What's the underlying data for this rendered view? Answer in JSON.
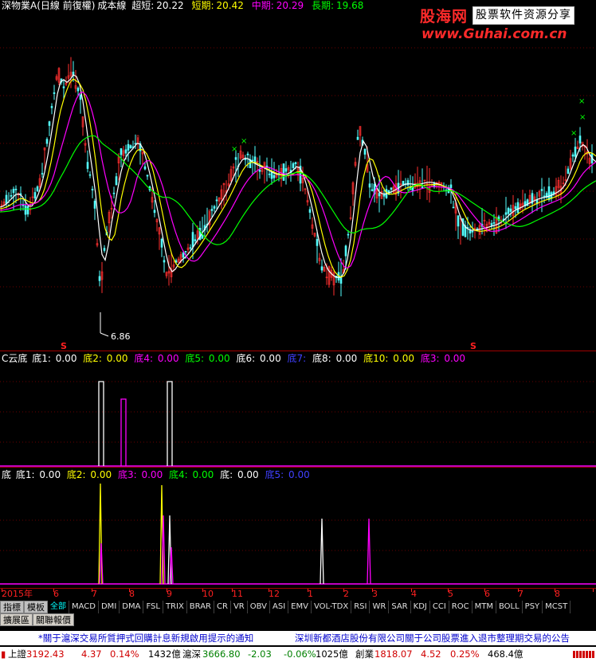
{
  "main": {
    "legend": {
      "title": "深物業A(日線 前復權)",
      "indicator": "成本線",
      "items": [
        {
          "label": "超短:",
          "value": "20.22",
          "color": "#ffffff"
        },
        {
          "label": "短期:",
          "value": "20.42",
          "color": "#ffff00"
        },
        {
          "label": "中期:",
          "value": "20.29",
          "color": "#ff00ff"
        },
        {
          "label": "長期:",
          "value": "19.68",
          "color": "#00ff00"
        }
      ]
    },
    "low_label": "6.86",
    "signal_glyph": "S"
  },
  "logo": {
    "name": "股海网",
    "slogan": "股票软件资源分享",
    "url": "www.Guhai.com.cn"
  },
  "ind1": {
    "name": "C云底",
    "items": [
      {
        "label": "底1:",
        "value": "0.00",
        "color": "#ffffff"
      },
      {
        "label": "底2:",
        "value": "0.00",
        "color": "#ffff00"
      },
      {
        "label": "底4:",
        "value": "0.00",
        "color": "#ff00ff"
      },
      {
        "label": "底5:",
        "value": "0.00",
        "color": "#00ff00"
      },
      {
        "label": "底6:",
        "value": "0.00",
        "color": "#ffffff"
      },
      {
        "label": "底7:",
        "value": "",
        "color": "#4040ff"
      },
      {
        "label": "底8:",
        "value": "0.00",
        "color": "#ffffff"
      },
      {
        "label": "底10:",
        "value": "0.00",
        "color": "#ffff00"
      },
      {
        "label": "底3:",
        "value": "0.00",
        "color": "#ff00ff"
      }
    ]
  },
  "ind2": {
    "name": "底",
    "items": [
      {
        "label": "底1:",
        "value": "0.00",
        "color": "#ffffff"
      },
      {
        "label": "底2:",
        "value": "0.00",
        "color": "#ffff00"
      },
      {
        "label": "底3:",
        "value": "0.00",
        "color": "#ff00ff"
      },
      {
        "label": "底4:",
        "value": "0.00",
        "color": "#00ff00"
      },
      {
        "label": "底:",
        "value": "0.00",
        "color": "#ffffff"
      },
      {
        "label": "底5:",
        "value": "0.00",
        "color": "#4040ff"
      }
    ]
  },
  "date_axis": [
    "2015年",
    "6",
    "7",
    "8",
    "9",
    "10",
    "11",
    "12",
    "1",
    "2",
    "3",
    "4",
    "5",
    "6",
    "7",
    "8"
  ],
  "tabs": {
    "side1": "指標",
    "side2": "模板",
    "items": [
      "全部",
      "MACD",
      "DMI",
      "DMA",
      "FSL",
      "TRIX",
      "BRAR",
      "CR",
      "VR",
      "OBV",
      "ASI",
      "EMV",
      "VOL-TDX",
      "RSI",
      "WR",
      "SAR",
      "KDJ",
      "CCI",
      "ROC",
      "MTM",
      "BOLL",
      "PSY",
      "MCST"
    ],
    "row2": [
      "擴展區",
      "關聯報價"
    ]
  },
  "notice": {
    "left": "*關于滬深交易所質押式回購計息新規啟用提示的通知",
    "right": "深圳新都酒店股份有限公司關于公司股票進入退市整理期交易的公告"
  },
  "status": {
    "sh_label": "上證",
    "sh_value": "3192.43",
    "sh_change": "4.37",
    "sh_pct": "0.14%",
    "sh_amount": "1432億",
    "hs_label": "滬深",
    "hs_value": "3666.80",
    "hs_change": "-2.03",
    "hs_pct": "-0.06%",
    "hs_amount": "1025億",
    "cy_label": "創業",
    "cy_value": "1818.07",
    "cy_change": "4.52",
    "cy_pct": "0.25%",
    "cy_amount": "468.4億"
  }
}
